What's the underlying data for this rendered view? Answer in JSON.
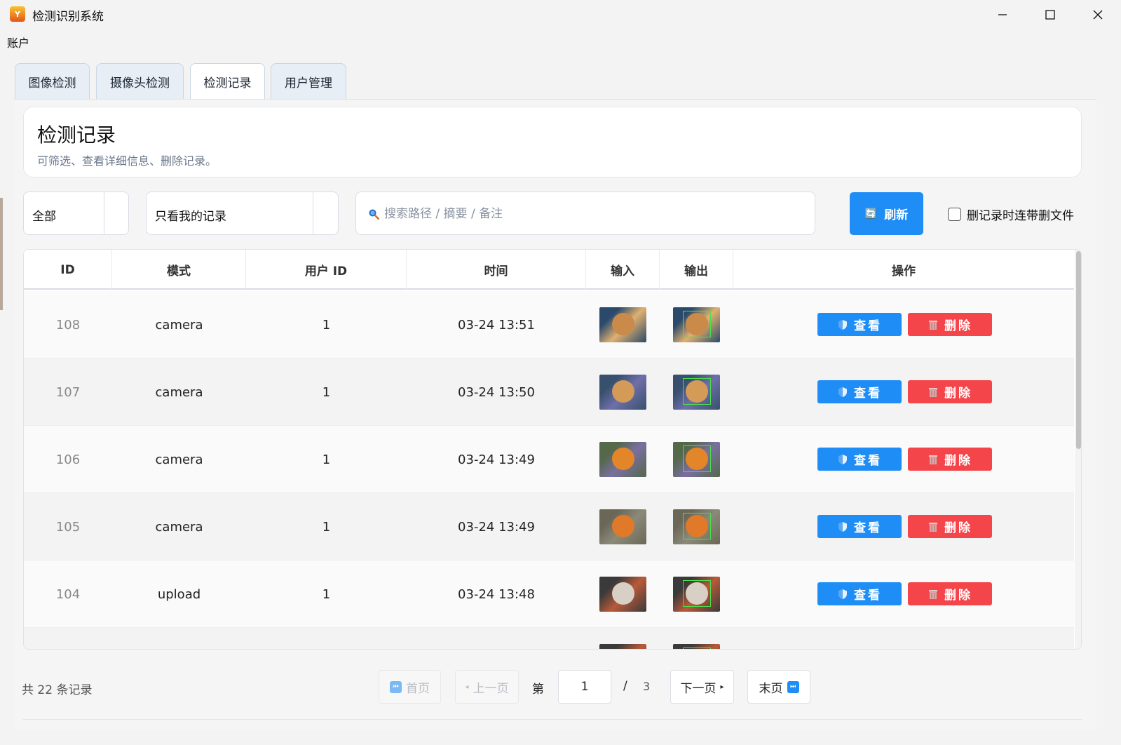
{
  "window": {
    "title": "检测识别系统",
    "icon_text": "YOLO",
    "controls": [
      "minimize-icon",
      "maximize-icon",
      "close-icon"
    ]
  },
  "menu": {
    "account": "账户"
  },
  "tabs": [
    {
      "label": "图像检测",
      "active": false
    },
    {
      "label": "摄像头检测",
      "active": false
    },
    {
      "label": "检测记录",
      "active": true
    },
    {
      "label": "用户管理",
      "active": false
    }
  ],
  "header": {
    "title": "检测记录",
    "subtitle": "可筛选、查看详细信息、删除记录。"
  },
  "filters": {
    "mode_value": "全部",
    "scope_value": "只看我的记录",
    "search_placeholder": "搜索路径 / 摘要 / 备注",
    "search_value": "",
    "refresh_label": "刷新",
    "delete_files_label": "删记录时连带删文件",
    "delete_files_checked": false
  },
  "table": {
    "columns": [
      "ID",
      "模式",
      "用户 ID",
      "时间",
      "输入",
      "输出",
      "操作"
    ],
    "view_label": "查看",
    "delete_label": "删除",
    "rows": [
      {
        "id": "108",
        "mode": "camera",
        "user_id": "1",
        "time": "03-24 13:51",
        "thumb": "pizza"
      },
      {
        "id": "107",
        "mode": "camera",
        "user_id": "1",
        "time": "03-24 13:50",
        "thumb": "pizza-hand"
      },
      {
        "id": "106",
        "mode": "camera",
        "user_id": "1",
        "time": "03-24 13:49",
        "thumb": "orange"
      },
      {
        "id": "105",
        "mode": "camera",
        "user_id": "1",
        "time": "03-24 13:49",
        "thumb": "orange-room"
      },
      {
        "id": "104",
        "mode": "upload",
        "user_id": "1",
        "time": "03-24 13:48",
        "thumb": "meal-tray"
      }
    ]
  },
  "pagination": {
    "total_text": "共 22 条记录",
    "first_label": "首页",
    "prev_label": "上一页",
    "page_prefix": "第",
    "current_page": "1",
    "separator": "/",
    "total_pages": "3",
    "next_label": "下一页",
    "last_label": "末页"
  },
  "colors": {
    "primary": "#1e8df5",
    "danger": "#f4454a",
    "tab_inactive_bg": "#e8eef6"
  }
}
